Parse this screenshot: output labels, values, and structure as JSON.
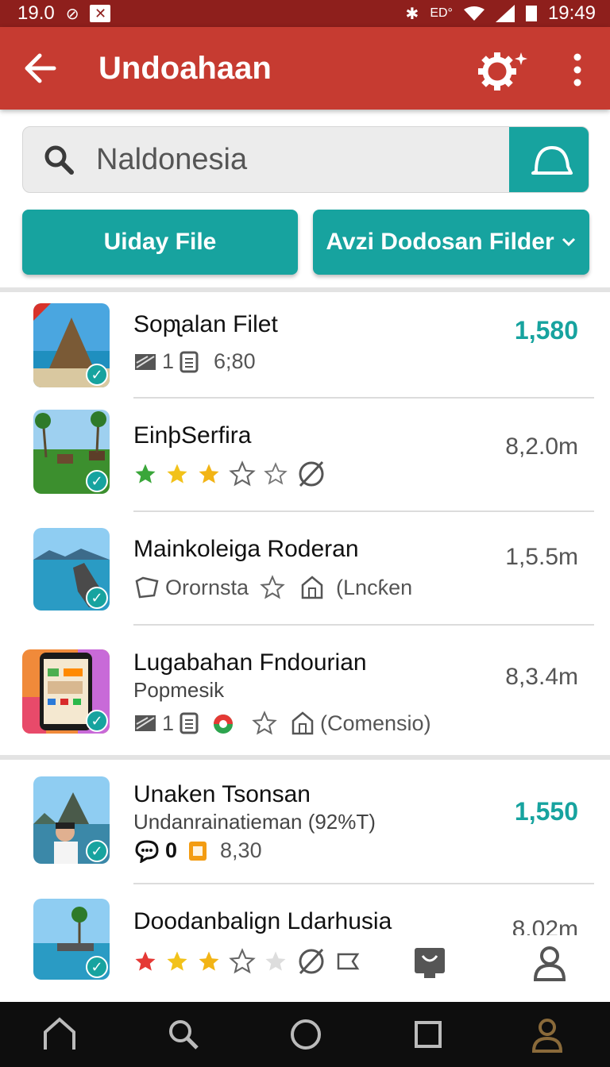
{
  "status_bar": {
    "left_time": "19.0",
    "right_time": "19:49",
    "notif_small": "ED°"
  },
  "app_bar": {
    "title": "Undoahaan",
    "back_icon": "arrow-left-icon",
    "settings_icon": "gear-sparkle-icon",
    "more_icon": "more-vertical-icon"
  },
  "search": {
    "value": "Naldonesia",
    "action_icon": "bell-icon"
  },
  "buttons": {
    "upload_label": "Uiday File",
    "filter_label": "Avzi Dodosan Filder"
  },
  "colors": {
    "app_bar": "#c63b31",
    "status_bar": "#8e1f1c",
    "accent": "#17a39f"
  },
  "items": [
    {
      "title": "Sopʅalan Filet",
      "meta_count": "1",
      "meta_text": "6;80",
      "value": "1,580"
    },
    {
      "title": "EinþSerfira",
      "rating_stars": 3,
      "value": "8,2.0m"
    },
    {
      "title": "Mainkoleiga Roderan",
      "meta_a": "Orornsta",
      "meta_b": "(Lncƙen",
      "value": "1,5.5m"
    },
    {
      "title": "Lugabahan Fndourian",
      "subtitle": "Popmesik",
      "meta_count": "1",
      "meta_b": "(Comensio)",
      "value": "8,3.4m"
    },
    {
      "title": "Unaken Tsonsan",
      "subtitle": "Undanrainatieman (92%T)",
      "meta_count": "0",
      "meta_text": "8,30",
      "value": "1,550"
    },
    {
      "title": "Doodanbalign Ldarhusia",
      "rating_stars": 3,
      "value": "8.02m"
    }
  ],
  "bottom_nav": [
    "home-icon",
    "search-icon",
    "circle-icon",
    "square-icon",
    "person-icon"
  ]
}
